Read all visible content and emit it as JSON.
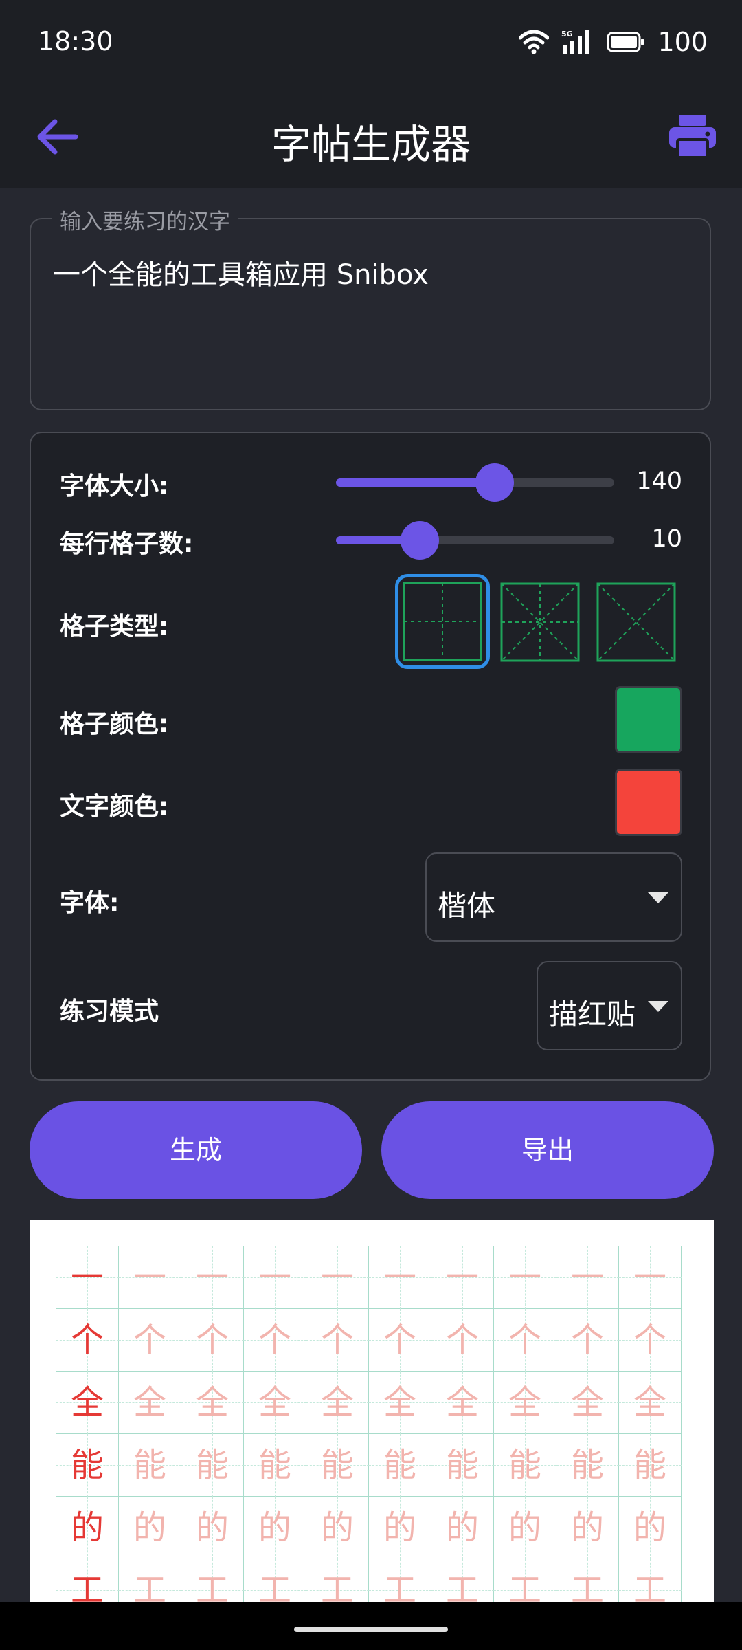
{
  "status": {
    "time": "18:30",
    "battery": "100"
  },
  "appbar": {
    "title": "字帖生成器"
  },
  "input": {
    "label": "输入要练习的汉字",
    "value": "一个全能的工具箱应用 Snibox"
  },
  "settings": {
    "font_size": {
      "label": "字体大小:",
      "value": "140",
      "fraction": 0.57
    },
    "cells_per_row": {
      "label": "每行格子数:",
      "value": "10",
      "fraction": 0.3
    },
    "grid_type": {
      "label": "格子类型:",
      "selected": "tian-zi-ge"
    },
    "grid_color": {
      "label": "格子颜色:",
      "color": "#17a65e"
    },
    "text_color": {
      "label": "文字颜色:",
      "color": "#f4443b"
    },
    "font": {
      "label": "字体:",
      "value": "楷体"
    },
    "practice_mode": {
      "label": "练习模式",
      "value": "描红贴"
    }
  },
  "buttons": {
    "generate": "生成",
    "export": "导出"
  },
  "preview": {
    "characters": [
      "一",
      "个",
      "全",
      "能",
      "的",
      "工"
    ]
  },
  "colors": {
    "accent": "#6a52e4",
    "background": "#262830",
    "appbar": "#1d1f24"
  }
}
